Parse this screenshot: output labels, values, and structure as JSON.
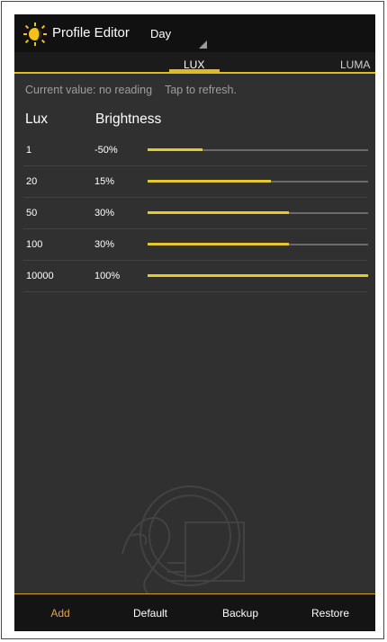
{
  "app": {
    "title": "Profile Editor",
    "profile_selected": "Day",
    "accent_color": "#e3b922"
  },
  "tabs": [
    {
      "label": "LUX",
      "selected": true
    },
    {
      "label": "LUMA",
      "selected": false
    }
  ],
  "status": {
    "current_value": "Current value: no reading",
    "refresh_hint": "Tap to refresh."
  },
  "table": {
    "headers": {
      "lux": "Lux",
      "brightness": "Brightness"
    },
    "rows": [
      {
        "lux": "1",
        "brightness": "-50%",
        "slider_fraction": 0.25
      },
      {
        "lux": "20",
        "brightness": "15%",
        "slider_fraction": 0.56
      },
      {
        "lux": "50",
        "brightness": "30%",
        "slider_fraction": 0.64
      },
      {
        "lux": "100",
        "brightness": "30%",
        "slider_fraction": 0.64
      },
      {
        "lux": "10000",
        "brightness": "100%",
        "slider_fraction": 1.0
      }
    ]
  },
  "bottom_bar": {
    "add": "Add",
    "default": "Default",
    "backup": "Backup",
    "restore": "Restore"
  },
  "icons": {
    "app_icon": "sun-icon",
    "spinner_icon": "spinner-corner-icon",
    "watermark": "dragon-watermark-icon"
  }
}
